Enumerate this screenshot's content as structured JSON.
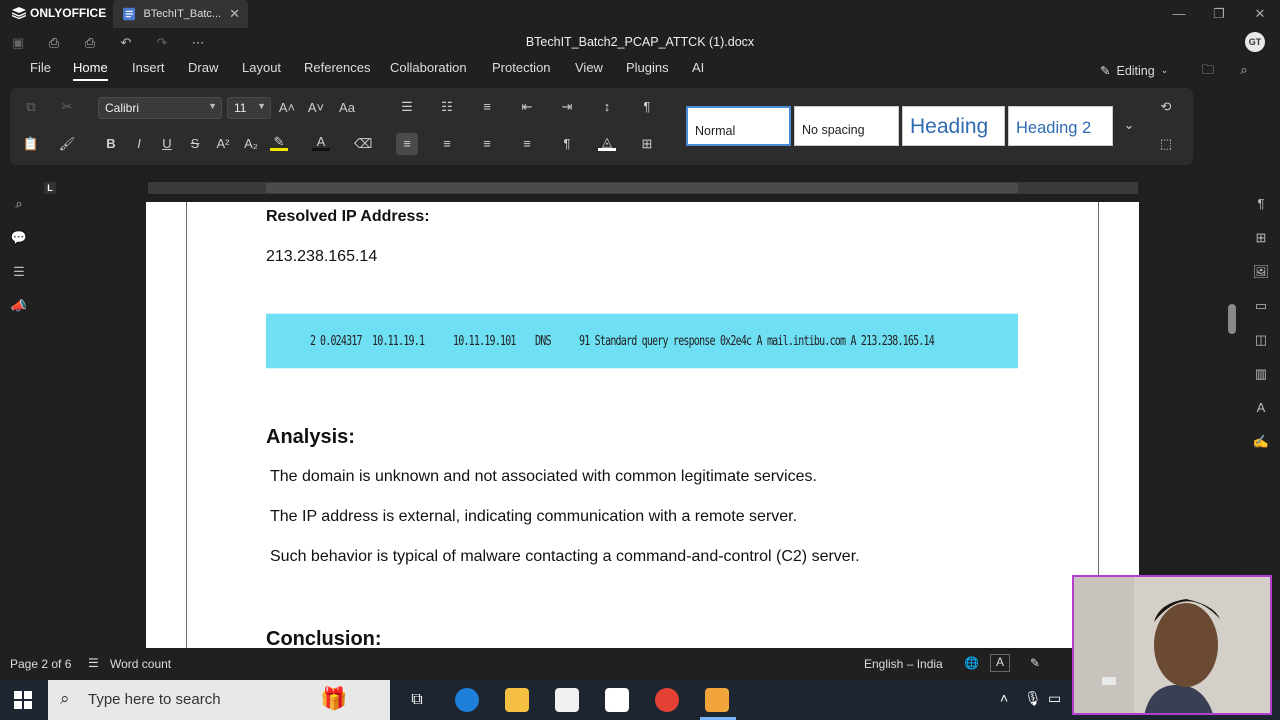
{
  "app": {
    "brand": "ONLYOFFICE",
    "tab_label": "BTechIT_Batc...",
    "document_title": "BTechIT_Batch2_PCAP_ATTCK (1).docx",
    "user_initials": "GT"
  },
  "menu": {
    "items": [
      "File",
      "Home",
      "Insert",
      "Draw",
      "Layout",
      "References",
      "Collaboration",
      "Protection",
      "View",
      "Plugins",
      "AI"
    ],
    "active": "Home",
    "mode_label": "Editing"
  },
  "toolbar": {
    "font_name": "Calibri",
    "font_size": "11",
    "styles": [
      "Normal",
      "No spacing",
      "Heading",
      "Heading 2"
    ]
  },
  "ruler": {
    "corner_label": "L"
  },
  "document": {
    "heading_resolved": "Resolved IP Address:",
    "resolved_ip": "213.238.165.14",
    "dns_row": {
      "no": "2",
      "time": "0.024317",
      "source": "10.11.19.1",
      "destination": "10.11.19.101",
      "protocol": "DNS",
      "info": "91 Standard query response 0x2e4c A mail.intibu.com A 213.238.165.14"
    },
    "heading_analysis": "Analysis:",
    "analysis_lines": [
      "The domain is unknown and not associated with common legitimate services.",
      "The IP address is external, indicating communication with a remote server.",
      "Such behavior is typical of malware contacting a command-and-control (C2) server."
    ],
    "heading_conclusion": "Conclusion:"
  },
  "status": {
    "page": "Page 2 of 6",
    "word_count": "Word count",
    "language": "English – India"
  },
  "taskbar": {
    "search_placeholder": "Type here to search"
  }
}
